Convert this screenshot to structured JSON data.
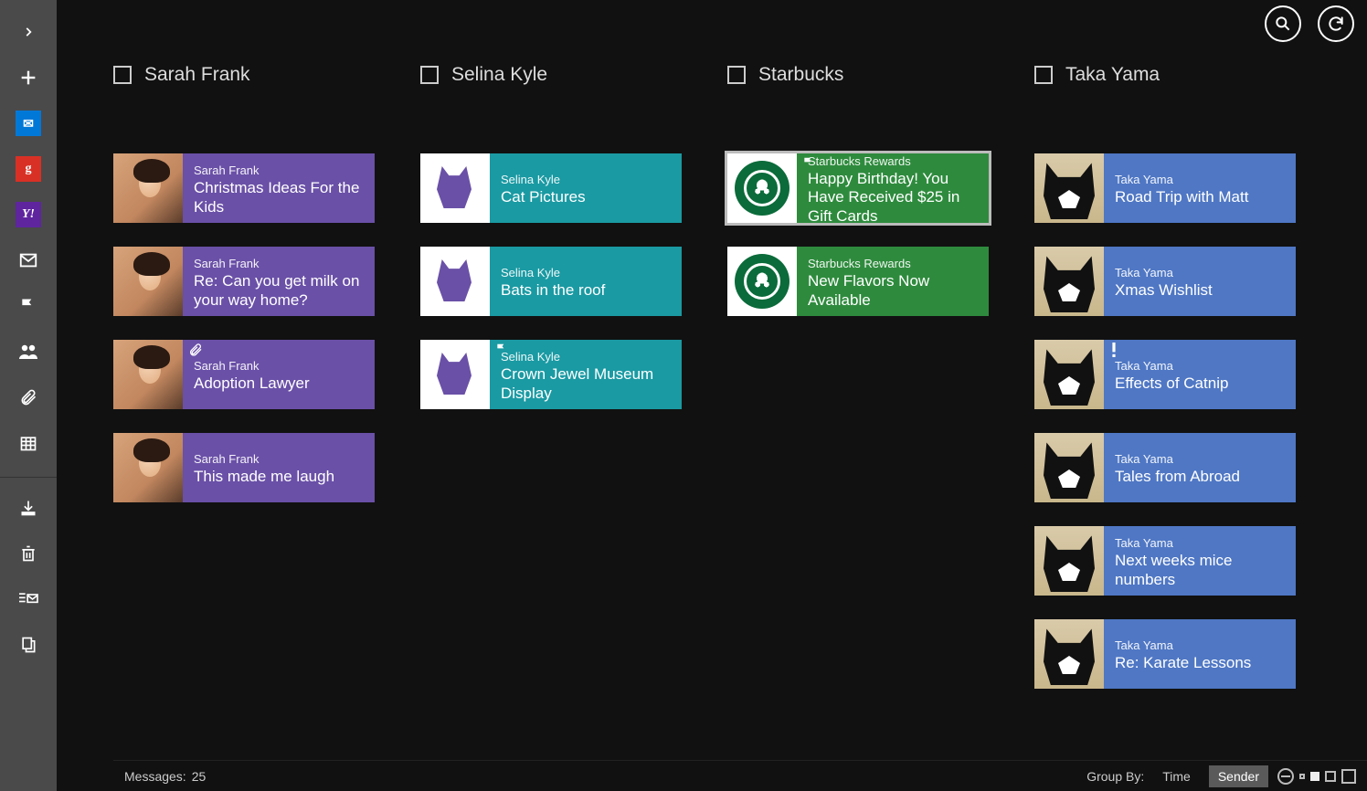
{
  "toolbar": {
    "search_label": "Search",
    "refresh_label": "Refresh"
  },
  "columns": [
    {
      "header": "Sarah Frank",
      "color": "purple",
      "avatar": "face",
      "items": [
        {
          "sender": "Sarah Frank",
          "subject": "Christmas Ideas For the Kids"
        },
        {
          "sender": "Sarah Frank",
          "subject": "Re: Can you get milk on your way home?"
        },
        {
          "sender": "Sarah Frank",
          "subject": "Adoption Lawyer",
          "attachment": true
        },
        {
          "sender": "Sarah Frank",
          "subject": "This made me laugh"
        }
      ]
    },
    {
      "header": "Selina Kyle",
      "color": "teal",
      "avatar": "catart",
      "items": [
        {
          "sender": "Selina Kyle",
          "subject": "Cat Pictures"
        },
        {
          "sender": "Selina Kyle",
          "subject": "Bats in the roof"
        },
        {
          "sender": "Selina Kyle",
          "subject": "Crown Jewel Museum Display",
          "flag": true
        }
      ]
    },
    {
      "header": "Starbucks",
      "color": "green",
      "avatar": "starbucks",
      "items": [
        {
          "sender": "Starbucks Rewards",
          "subject": "Happy Birthday! You Have Received $25 in Gift Cards",
          "flag": true,
          "selected": true
        },
        {
          "sender": "Starbucks Rewards",
          "subject": "New Flavors Now Available"
        }
      ]
    },
    {
      "header": "Taka Yama",
      "color": "blue",
      "avatar": "catphoto",
      "items": [
        {
          "sender": "Taka Yama",
          "subject": "Road Trip with Matt"
        },
        {
          "sender": "Taka Yama",
          "subject": "Xmas Wishlist"
        },
        {
          "sender": "Taka Yama",
          "subject": "Effects of Catnip",
          "important": true
        },
        {
          "sender": "Taka Yama",
          "subject": "Tales from Abroad"
        },
        {
          "sender": "Taka Yama",
          "subject": "Next weeks mice numbers"
        },
        {
          "sender": "Taka Yama",
          "subject": "Re: Karate Lessons"
        }
      ]
    }
  ],
  "footer": {
    "messages_label": "Messages:",
    "messages_count": "25",
    "group_by_label": "Group By:",
    "group_time": "Time",
    "group_sender": "Sender"
  }
}
